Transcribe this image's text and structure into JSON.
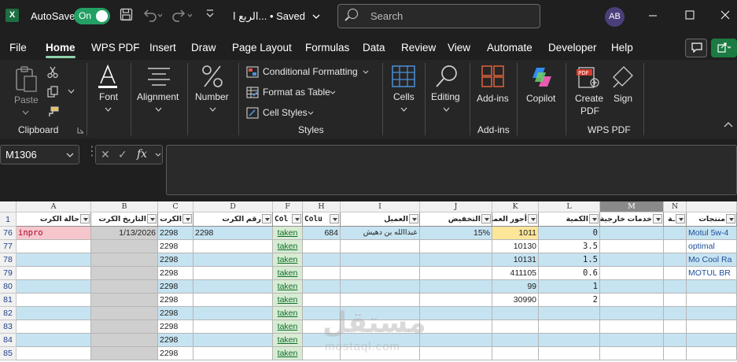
{
  "titlebar": {
    "app_icon": "X",
    "autosave_label": "AutoSave",
    "autosave_state": "On",
    "doc_title": "الربع ا... • Saved",
    "search_placeholder": "Search",
    "user_initials": "AB"
  },
  "menu": {
    "items": [
      "File",
      "Home",
      "WPS PDF",
      "Insert",
      "Draw",
      "Page Layout",
      "Formulas",
      "Data",
      "Review",
      "View",
      "Automate",
      "Developer",
      "Help"
    ],
    "active": "Home"
  },
  "ribbon": {
    "clipboard": {
      "paste": "Paste",
      "group": "Clipboard"
    },
    "font": "Font",
    "alignment": "Alignment",
    "number": "Number",
    "styles": {
      "conditional": "Conditional Formatting",
      "format_table": "Format as Table",
      "cell_styles": "Cell Styles",
      "group": "Styles"
    },
    "cells": "Cells",
    "editing": "Editing",
    "addins": {
      "label": "Add-ins",
      "group": "Add-ins"
    },
    "copilot": "Copilot",
    "wps": {
      "create_pdf_1": "Create",
      "create_pdf_2": "PDF",
      "sign": "Sign",
      "group": "WPS PDF"
    }
  },
  "formula_bar": {
    "name_box": "M1306",
    "fx": "fx"
  },
  "sheet": {
    "columns": [
      "A",
      "B",
      "C",
      "D",
      "F",
      "H",
      "I",
      "J",
      "K",
      "L",
      "M",
      "N"
    ],
    "selected_column": "M",
    "header_row": {
      "row": "1",
      "A": "حالة الكرت",
      "B": "التاريخ الكرت",
      "C": "الكرت",
      "D": "رقم الكرت",
      "F": "Col",
      "H": "Colu",
      "I": "العميل",
      "J": "التخفيض",
      "K": "أجور العمل",
      "L": "الكمية",
      "M": "خدمات خارجية",
      "N": "ـة",
      "O": "منتجات"
    },
    "rows": [
      {
        "row": "76",
        "A": "inpro",
        "B": "1/13/2026",
        "C": "2298",
        "D": "2298",
        "F": "taken",
        "H": "684",
        "I": "عبداالله بن دهيش",
        "J": "15%",
        "K": "1011",
        "L": "0",
        "O": "Motul 5w-4"
      },
      {
        "row": "77",
        "A": "",
        "B": "",
        "C": "2298",
        "D": "",
        "F": "taken",
        "H": "",
        "I": "",
        "J": "",
        "K": "10130",
        "L": "3.5",
        "O": "optimal"
      },
      {
        "row": "78",
        "A": "",
        "B": "",
        "C": "2298",
        "D": "",
        "F": "taken",
        "H": "",
        "I": "",
        "J": "",
        "K": "10131",
        "L": "1.5",
        "O": "Mo Cool Ra"
      },
      {
        "row": "79",
        "A": "",
        "B": "",
        "C": "2298",
        "D": "",
        "F": "taken",
        "H": "",
        "I": "",
        "J": "",
        "K": "411105",
        "L": "0.6",
        "O": "MOTUL BR"
      },
      {
        "row": "80",
        "A": "",
        "B": "",
        "C": "2298",
        "D": "",
        "F": "taken",
        "H": "",
        "I": "",
        "J": "",
        "K": "99",
        "L": "1",
        "O": ""
      },
      {
        "row": "81",
        "A": "",
        "B": "",
        "C": "2298",
        "D": "",
        "F": "taken",
        "H": "",
        "I": "",
        "J": "",
        "K": "30990",
        "L": "2",
        "O": ""
      },
      {
        "row": "82",
        "A": "",
        "B": "",
        "C": "2298",
        "D": "",
        "F": "taken",
        "H": "",
        "I": "",
        "J": "",
        "K": "",
        "L": "",
        "O": ""
      },
      {
        "row": "83",
        "A": "",
        "B": "",
        "C": "2298",
        "D": "",
        "F": "taken",
        "H": "",
        "I": "",
        "J": "",
        "K": "",
        "L": "",
        "O": ""
      },
      {
        "row": "84",
        "A": "",
        "B": "",
        "C": "2298",
        "D": "",
        "F": "taken",
        "H": "",
        "I": "",
        "J": "",
        "K": "",
        "L": "",
        "O": ""
      },
      {
        "row": "85",
        "A": "",
        "B": "",
        "C": "2298",
        "D": "",
        "F": "taken",
        "H": "",
        "I": "",
        "J": "",
        "K": "",
        "L": "",
        "O": ""
      }
    ],
    "watermark": "مستقل",
    "watermark_url": "mostaql.com"
  },
  "colors": {
    "accent": "#24a064",
    "row_blue": "#c6e3f1",
    "gray_fill": "#cfcfcf",
    "pink_fill": "#f6c6cd",
    "green_fill": "#d8ecd3",
    "yellow_fill": "#fde59a"
  }
}
